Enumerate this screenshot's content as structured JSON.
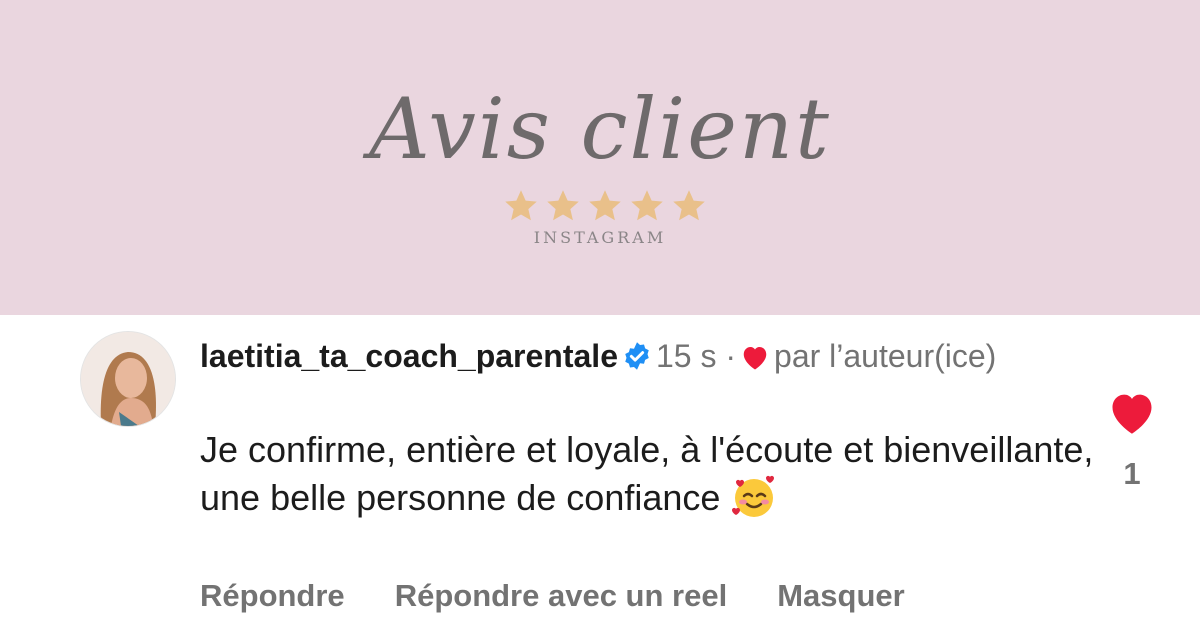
{
  "banner": {
    "title": "Avis client",
    "subtitle": "INSTAGRAM",
    "rating_stars": 5,
    "star_color": "#e9c08a",
    "background": "#ead6df"
  },
  "comment": {
    "username": "laetitia_ta_coach_parentale",
    "verified_icon": "verified-badge-icon",
    "time": "15 s",
    "separator": "·",
    "liked_by_author": "par l’auteur(ice)",
    "text": "Je confirme, entière et loyale, à l'écoute et bienveillante, une belle personne de confiance",
    "emoji": "smiling-face-with-hearts",
    "actions": {
      "reply": "Répondre",
      "reply_reel": "Répondre avec un reel",
      "hide": "Masquer"
    },
    "like_count": "1",
    "heart_color": "#ed1b3b",
    "verified_color": "#1f8ff5"
  }
}
